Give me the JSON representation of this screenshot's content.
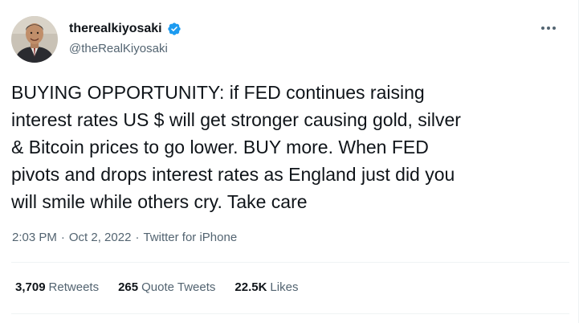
{
  "author": {
    "display_name": "therealkiyosaki",
    "handle": "@theRealKiyosaki",
    "verified": true,
    "avatar_icon": "profile-photo"
  },
  "more_icon": "ellipsis-icon",
  "tweet": {
    "text": "BUYING OPPORTUNITY: if FED continues raising\ninterest rates US $ will get stronger causing gold, silver\n& Bitcoin prices to go lower. BUY more.  When FED\npivots and drops interest rates as England just did you\nwill smile while others cry. Take care"
  },
  "meta": {
    "time": "2:03 PM",
    "separator": "·",
    "date": "Oct 2, 2022",
    "source": "Twitter for iPhone"
  },
  "stats": {
    "retweets": {
      "count": "3,709",
      "label": "Retweets"
    },
    "quote_tweets": {
      "count": "265",
      "label": "Quote Tweets"
    },
    "likes": {
      "count": "22.5K",
      "label": "Likes"
    }
  },
  "colors": {
    "text_primary": "#0f1419",
    "text_secondary": "#536471",
    "verified_blue": "#1d9bf0",
    "divider": "#eff3f4"
  }
}
